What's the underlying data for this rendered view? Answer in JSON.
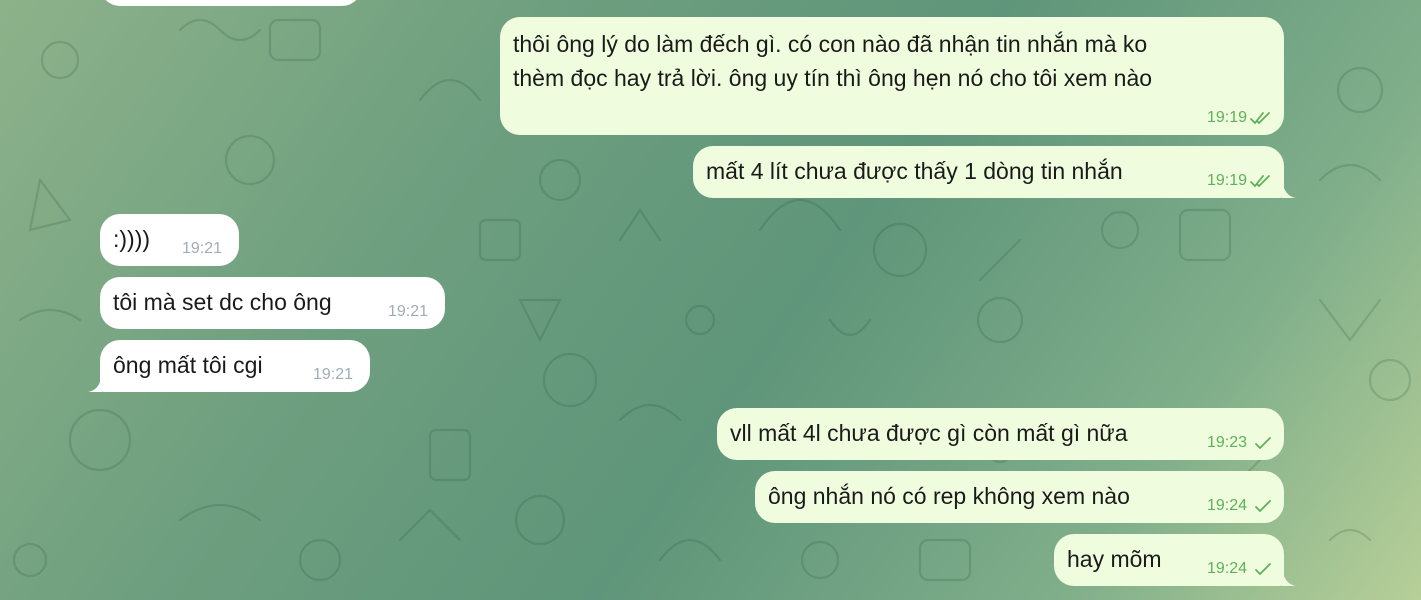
{
  "messages": [
    {
      "text_line1": "thôi ông lý do làm đếch gì. có con nào đã nhận tin nhắn mà ko",
      "text_line2": "thèm đọc hay trả lời. ông uy tín thì ông hẹn nó cho tôi xem nào",
      "time": "19:19",
      "status": "read-double-check"
    },
    {
      "text": "mất 4 lít chưa được thấy 1 dòng tin nhắn",
      "time": "19:19",
      "status": "read-double-check"
    },
    {
      "text": ":))))",
      "time": "19:21"
    },
    {
      "text": "tôi mà set dc cho ông",
      "time": "19:21"
    },
    {
      "text": "ông mất tôi cgi",
      "time": "19:21"
    },
    {
      "text": "vll mất 4l chưa được gì còn mất gì nữa",
      "time": "19:23",
      "status": "sent-check"
    },
    {
      "text": "ông nhắn nó có rep không xem nào",
      "time": "19:24",
      "status": "sent-check"
    },
    {
      "text": "hay mõm",
      "time": "19:24",
      "status": "sent-check"
    }
  ],
  "colors": {
    "outgoing_bubble": "#effdde",
    "incoming_bubble": "#ffffff",
    "outgoing_meta": "#5fb05a",
    "incoming_meta": "#a0acb6"
  }
}
